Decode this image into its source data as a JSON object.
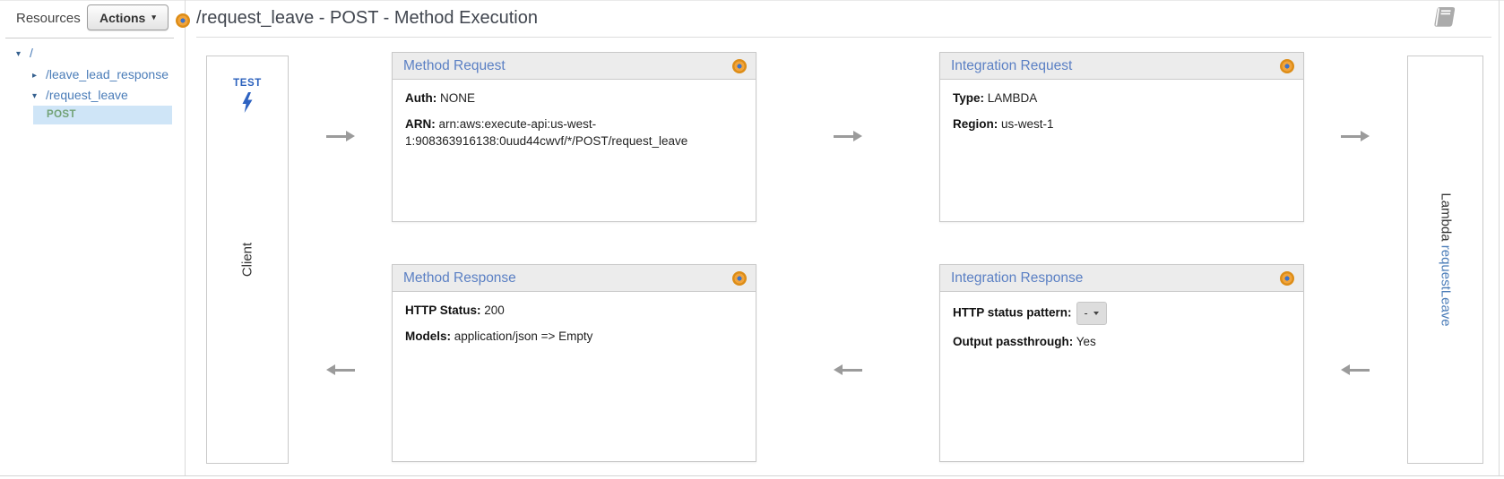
{
  "sidebar": {
    "title": "Resources",
    "actions_label": "Actions",
    "tree": {
      "root": "/",
      "leave_lead_response": "/leave_lead_response",
      "request_leave": "/request_leave",
      "post_method": "POST"
    }
  },
  "header": {
    "title": "/request_leave - POST - Method Execution"
  },
  "icons": {
    "expander_open": "▾",
    "expander_closed": "▸",
    "actions_caret": "▾",
    "method_target": "bullseye-icon",
    "docs": "book-icon",
    "test_bolt": "lightning-bolt-icon"
  },
  "diagram": {
    "client": {
      "test_label": "TEST",
      "label": "Client"
    },
    "lambda": {
      "prefix": "Lambda",
      "function_name": "requestLeave"
    },
    "method_request": {
      "title": "Method Request",
      "auth_label": "Auth:",
      "auth_value": "NONE",
      "arn_label": "ARN:",
      "arn_value": "arn:aws:execute-api:us-west-1:908363916138:0uud44cwvf/*/POST/request_leave"
    },
    "integration_request": {
      "title": "Integration Request",
      "type_label": "Type:",
      "type_value": "LAMBDA",
      "region_label": "Region:",
      "region_value": "us-west-1"
    },
    "method_response": {
      "title": "Method Response",
      "http_status_label": "HTTP Status:",
      "http_status_value": "200",
      "models_label": "Models:",
      "models_value": "application/json => Empty"
    },
    "integration_response": {
      "title": "Integration Response",
      "pattern_label": "HTTP status pattern:",
      "pattern_value": "-",
      "passthrough_label": "Output passthrough:",
      "passthrough_value": "Yes"
    }
  },
  "colors": {
    "panel_title_blue": "#5b80c4",
    "link_blue": "#4a7cb8",
    "post_green": "#72a276",
    "accent_orange": "#f1a43c",
    "selected_row_blue": "#cfe5f7",
    "arrow_gray": "#9b9b9b"
  }
}
